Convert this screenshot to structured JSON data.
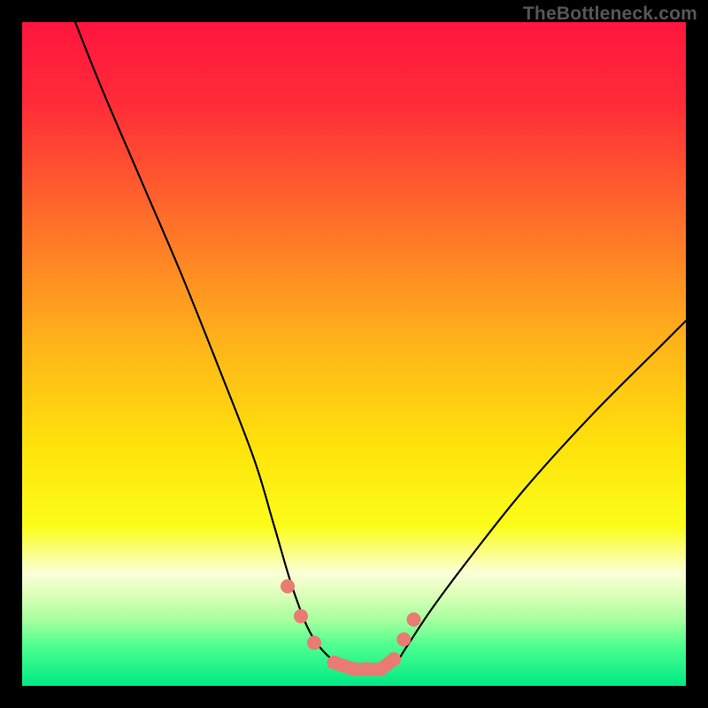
{
  "watermark": "TheBottleneck.com",
  "chart_data": {
    "type": "line",
    "title": "",
    "xlabel": "",
    "ylabel": "",
    "xlim": [
      0,
      100
    ],
    "ylim": [
      0,
      100
    ],
    "note": "Unlabeled bottleneck curve on a red-to-green vertical gradient background. Values estimated from pixel positions; no axis ticks or numeric labels are rendered in the source image.",
    "background_gradient_stops": [
      {
        "pct": 0,
        "color": "#ff153e"
      },
      {
        "pct": 12,
        "color": "#ff2b38"
      },
      {
        "pct": 30,
        "color": "#ff6f2a"
      },
      {
        "pct": 48,
        "color": "#ffb21a"
      },
      {
        "pct": 64,
        "color": "#ffe30b"
      },
      {
        "pct": 76,
        "color": "#fbfd1a"
      },
      {
        "pct": 81,
        "color": "#faffa3"
      },
      {
        "pct": 83,
        "color": "#fbffd8"
      },
      {
        "pct": 86,
        "color": "#dfffbb"
      },
      {
        "pct": 90,
        "color": "#a8ff9e"
      },
      {
        "pct": 94,
        "color": "#4dff90"
      },
      {
        "pct": 100,
        "color": "#00e884"
      }
    ],
    "series": [
      {
        "name": "bottleneck-curve",
        "x": [
          8,
          12,
          18,
          24,
          30,
          35,
          38,
          41,
          44,
          48,
          51,
          54,
          56,
          58,
          62,
          68,
          76,
          86,
          96,
          100
        ],
        "y": [
          100,
          90,
          76,
          62,
          47,
          34,
          24,
          14,
          7,
          3,
          2,
          2,
          3,
          6,
          12,
          20,
          30,
          41,
          51,
          55
        ]
      }
    ],
    "markers": {
      "name": "highlight-cluster",
      "color": "#e97b73",
      "points": [
        {
          "x": 40,
          "y": 15
        },
        {
          "x": 42,
          "y": 10.5
        },
        {
          "x": 44,
          "y": 6.5
        },
        {
          "x": 47,
          "y": 3.5
        },
        {
          "x": 50,
          "y": 2.5
        },
        {
          "x": 52,
          "y": 2.5
        },
        {
          "x": 54,
          "y": 2.5
        },
        {
          "x": 56,
          "y": 4
        },
        {
          "x": 57.5,
          "y": 7
        },
        {
          "x": 59,
          "y": 10
        }
      ]
    }
  }
}
